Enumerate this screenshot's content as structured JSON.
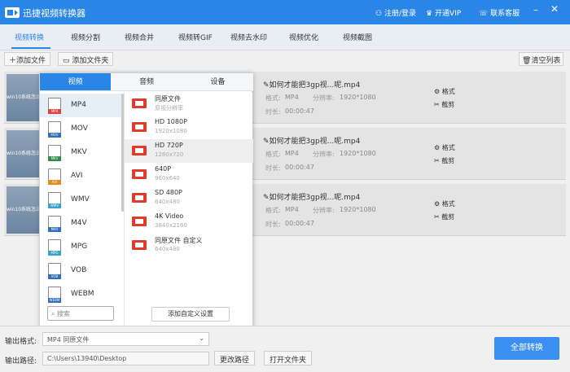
{
  "app": {
    "title": "迅捷视频转换器",
    "user": "注册/登录",
    "vip": "开通VIP",
    "support": "联系客服"
  },
  "tabs": [
    "视频转换",
    "视频分割",
    "视频合并",
    "视频转GIF",
    "视频去水印",
    "视频优化",
    "视频截图"
  ],
  "toolbar": {
    "add_file": "添加文件",
    "add_folder": "添加文件夹",
    "clear": "清空列表"
  },
  "files": [
    {
      "name": "如何才能把3gp视...呢.mp4",
      "format_label": "格式:",
      "format": "MP4",
      "res_label": "分辨率:",
      "res": "1920*1080",
      "dur_label": "时长:",
      "dur": "00:00:47",
      "thumb": "win10系统怎么"
    },
    {
      "name": "如何才能把3gp视...呢.mp4",
      "format_label": "格式:",
      "format": "MP4",
      "res_label": "分辨率:",
      "res": "1920*1080",
      "dur_label": "时长:",
      "dur": "00:00:47",
      "thumb": "win10系统怎么"
    },
    {
      "name": "如何才能把3gp视...呢.mp4",
      "format_label": "格式:",
      "format": "MP4",
      "res_label": "分辨率:",
      "res": "1920*1080",
      "dur_label": "时长:",
      "dur": "00:00:47",
      "thumb": "win10系统怎么"
    }
  ],
  "actions": {
    "format": "格式",
    "cut": "截剪"
  },
  "popup": {
    "tabs": [
      "视频",
      "音频",
      "设备"
    ],
    "formats": [
      "MP4",
      "MOV",
      "MKV",
      "AVI",
      "WMV",
      "M4V",
      "MPG",
      "VOB",
      "WEBM"
    ],
    "search_placeholder": "搜索",
    "qualities": [
      {
        "name": "同原文件",
        "sub": "原视分辨率"
      },
      {
        "name": "HD 1080P",
        "sub": "1920x1080"
      },
      {
        "name": "HD 720P",
        "sub": "1280x720"
      },
      {
        "name": "640P",
        "sub": "960x640"
      },
      {
        "name": "SD 480P",
        "sub": "640x480"
      },
      {
        "name": "4K Video",
        "sub": "3840x2160"
      },
      {
        "name": "同原文件 自定义",
        "sub": "640x480"
      }
    ],
    "add_custom": "添加自定义设置"
  },
  "bottom": {
    "format_label": "输出格式:",
    "format_value": "MP4  同原文件",
    "path_label": "输出路径:",
    "path_value": "C:\\Users\\13940\\Desktop",
    "change_path": "更改路径",
    "open_folder": "打开文件夹",
    "convert_all": "全部转换"
  },
  "colors": {
    "brand": "#2a86e6",
    "quality_icon": "#e03b2b",
    "format_tags": [
      "#d9463a",
      "#2f6fbd",
      "#2e8b4a",
      "#e58a1f",
      "#38a3c8",
      "#2f6fbd",
      "#38a3c8",
      "#2f6fbd",
      "#2f6fbd"
    ]
  }
}
